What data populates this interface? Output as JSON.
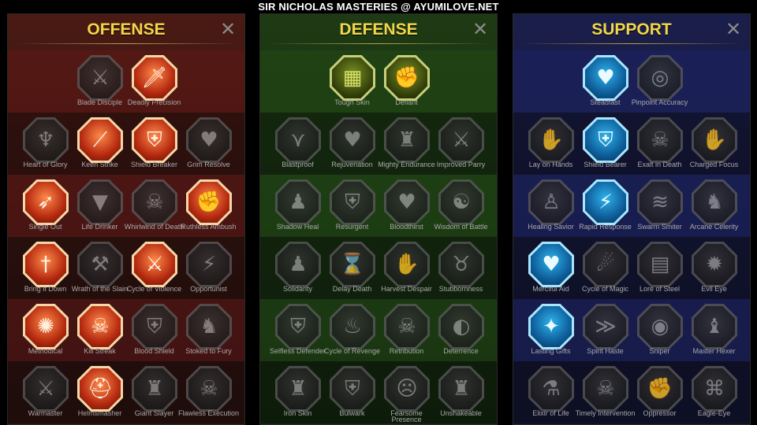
{
  "header": {
    "title": "SIR NICHOLAS MASTERIES @ AYUMILOVE.NET"
  },
  "close_glyph": "✕",
  "colors": {
    "title_gold": "#f2d64a",
    "offense_bg": "#3a1612",
    "defense_bg": "#193312",
    "support_bg": "#171a3e"
  },
  "panels": [
    {
      "key": "offense",
      "title": "OFFENSE",
      "rows": [
        [
          {
            "label": "Blade Disciple",
            "icon": "crossed-swords-icon",
            "active": false
          },
          {
            "label": "Deadly Precision",
            "icon": "dagger-icon",
            "active": true
          }
        ],
        [
          {
            "label": "Heart of Glory",
            "icon": "horned-helm-icon",
            "active": false
          },
          {
            "label": "Keen Strike",
            "icon": "slash-icon",
            "active": true
          },
          {
            "label": "Shield Breaker",
            "icon": "broken-shield-icon",
            "active": true
          },
          {
            "label": "Grim Resolve",
            "icon": "dark-heart-icon",
            "active": false
          }
        ],
        [
          {
            "label": "Single Out",
            "icon": "arrows-target-icon",
            "active": true
          },
          {
            "label": "Life Drinker",
            "icon": "fangs-icon",
            "active": false
          },
          {
            "label": "Whirlwind of Death",
            "icon": "skull-whirl-icon",
            "active": false
          },
          {
            "label": "Ruthless Ambush",
            "icon": "fist-blade-icon",
            "active": true
          }
        ],
        [
          {
            "label": "Bring it Down",
            "icon": "sword-down-icon",
            "active": true
          },
          {
            "label": "Wrath of the Slain",
            "icon": "hammer-fist-icon",
            "active": false
          },
          {
            "label": "Cycle of Violence",
            "icon": "axe-icon",
            "active": true
          },
          {
            "label": "Opportunist",
            "icon": "chain-lightning-icon",
            "active": false
          }
        ],
        [
          {
            "label": "Methodical",
            "icon": "burst-icon",
            "active": true
          },
          {
            "label": "Kill Streak",
            "icon": "skull-icon",
            "active": true
          },
          {
            "label": "Blood Shield",
            "icon": "blood-shield-icon",
            "active": false
          },
          {
            "label": "Stoked to Fury",
            "icon": "fury-figure-icon",
            "active": false
          }
        ],
        [
          {
            "label": "Warmaster",
            "icon": "war-sword-icon",
            "active": false
          },
          {
            "label": "Helmsmasher",
            "icon": "helmet-icon",
            "active": true
          },
          {
            "label": "Giant Slayer",
            "icon": "giant-icon",
            "active": false
          },
          {
            "label": "Flawless Execution",
            "icon": "executioner-icon",
            "active": false
          }
        ]
      ]
    },
    {
      "key": "defense",
      "title": "DEFENSE",
      "rows": [
        [
          {
            "label": "Tough Skin",
            "icon": "scales-icon",
            "active": true
          },
          {
            "label": "Defiant",
            "icon": "raised-fist-icon",
            "active": true
          }
        ],
        [
          {
            "label": "Blastproof",
            "icon": "chevron-armor-icon",
            "active": false
          },
          {
            "label": "Rejuvenation",
            "icon": "heart-hand-icon",
            "active": false
          },
          {
            "label": "Mighty Endurance",
            "icon": "strongman-icon",
            "active": false
          },
          {
            "label": "Improved Parry",
            "icon": "parry-blades-icon",
            "active": false
          }
        ],
        [
          {
            "label": "Shadow Heal",
            "icon": "shadow-figure-icon",
            "active": false
          },
          {
            "label": "Resurgent",
            "icon": "knight-shield-icon",
            "active": false
          },
          {
            "label": "Bloodthirst",
            "icon": "skull-heart-icon",
            "active": false
          },
          {
            "label": "Wisdom of Battle",
            "icon": "wise-head-icon",
            "active": false
          }
        ],
        [
          {
            "label": "Solidarity",
            "icon": "crowd-icon",
            "active": false
          },
          {
            "label": "Delay Death",
            "icon": "hourglass-icon",
            "active": false
          },
          {
            "label": "Harvest Despair",
            "icon": "open-hand-icon",
            "active": false
          },
          {
            "label": "Stubbornness",
            "icon": "bull-icon",
            "active": false
          }
        ],
        [
          {
            "label": "Selfless Defender",
            "icon": "defender-icon",
            "active": false
          },
          {
            "label": "Cycle of Revenge",
            "icon": "flames-icon",
            "active": false
          },
          {
            "label": "Retribution",
            "icon": "spiked-skull-icon",
            "active": false
          },
          {
            "label": "Deterrence",
            "icon": "deflect-icon",
            "active": false
          }
        ],
        [
          {
            "label": "Iron Skin",
            "icon": "iron-figure-icon",
            "active": false
          },
          {
            "label": "Bulwark",
            "icon": "bulwark-shield-icon",
            "active": false
          },
          {
            "label": "Fearsome Presence",
            "icon": "demon-face-icon",
            "active": false
          },
          {
            "label": "Unshakeable",
            "icon": "flex-figure-icon",
            "active": false
          }
        ]
      ]
    },
    {
      "key": "support",
      "title": "SUPPORT",
      "rows": [
        [
          {
            "label": "Steadfast",
            "icon": "heart-plus-icon",
            "active": true
          },
          {
            "label": "Pinpoint Accuracy",
            "icon": "spiral-target-icon",
            "active": false
          }
        ],
        [
          {
            "label": "Lay on Hands",
            "icon": "praying-hands-icon",
            "active": false
          },
          {
            "label": "Shield Bearer",
            "icon": "aura-shield-icon",
            "active": true
          },
          {
            "label": "Exalt in Death",
            "icon": "skull-smoke-icon",
            "active": false
          },
          {
            "label": "Charged Focus",
            "icon": "charged-hand-icon",
            "active": false
          }
        ],
        [
          {
            "label": "Healing Savior",
            "icon": "savior-figure-icon",
            "active": false
          },
          {
            "label": "Rapid Response",
            "icon": "lightning-icon",
            "active": true
          },
          {
            "label": "Swarm Smiter",
            "icon": "swarm-icon",
            "active": false
          },
          {
            "label": "Arcane Celerity",
            "icon": "runner-icon",
            "active": false
          }
        ],
        [
          {
            "label": "Merciful Aid",
            "icon": "chained-heart-icon",
            "active": true
          },
          {
            "label": "Cycle of Magic",
            "icon": "comet-icon",
            "active": false
          },
          {
            "label": "Lore of Steel",
            "icon": "book-icon",
            "active": false
          },
          {
            "label": "Evil Eye",
            "icon": "evil-eye-icon",
            "active": false
          }
        ],
        [
          {
            "label": "Lasting Gifts",
            "icon": "compass-star-icon",
            "active": true
          },
          {
            "label": "Spirit Haste",
            "icon": "winged-boot-icon",
            "active": false
          },
          {
            "label": "Sniper",
            "icon": "eye-icon",
            "active": false
          },
          {
            "label": "Master Hexer",
            "icon": "hex-figure-icon",
            "active": false
          }
        ],
        [
          {
            "label": "Elixir of Life",
            "icon": "potion-icon",
            "active": false
          },
          {
            "label": "Timely Intervention",
            "icon": "timely-skull-icon",
            "active": false
          },
          {
            "label": "Oppressor",
            "icon": "gauntlet-icon",
            "active": false
          },
          {
            "label": "Eagle-Eye",
            "icon": "eagle-icon",
            "active": false
          }
        ]
      ]
    }
  ]
}
